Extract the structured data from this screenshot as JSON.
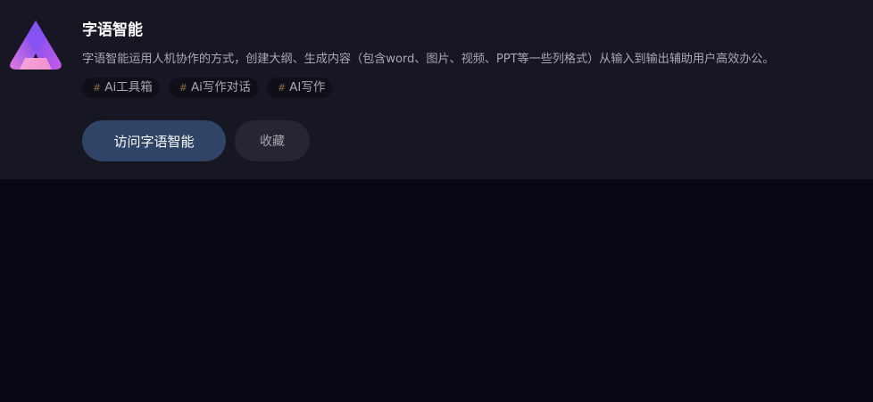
{
  "tool": {
    "name": "字语智能",
    "description": "字语智能运用人机协作的方式，创建大纲、生成内容（包含word、图片、视频、PPT等一些列格式）从输入到输出辅助用户高效办公。",
    "logo_icon": "ziyu-triangle-logo-icon",
    "tags": [
      {
        "hash": "#",
        "label": "Ai工具箱"
      },
      {
        "hash": "#",
        "label": "Ai写作对话"
      },
      {
        "hash": "#",
        "label": "AI写作"
      }
    ]
  },
  "actions": {
    "visit_label": "访问字语智能",
    "favorite_label": "收藏"
  },
  "colors": {
    "page_bg": "#080814",
    "card_bg": "#171724",
    "visit_button": "#2f4466",
    "favorite_button": "#262633",
    "tag_hash": "#8a6a3c"
  }
}
